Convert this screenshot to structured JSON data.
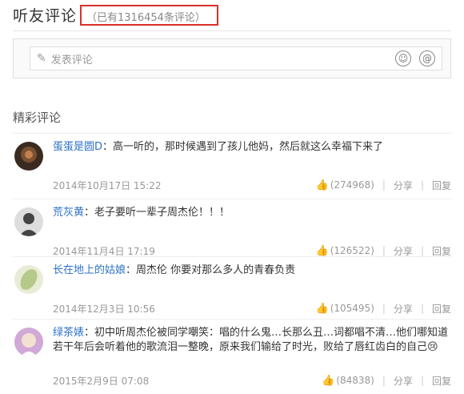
{
  "header": {
    "title": "听友评论",
    "count_text": "（已有1316454条评论）"
  },
  "comment_input": {
    "placeholder": "发表评论"
  },
  "section": {
    "title": "精彩评论"
  },
  "actions": {
    "share": "分享",
    "reply": "回复"
  },
  "comments": [
    {
      "name": "蛋蛋是圆D",
      "text": "：高一听的，那时候遇到了孩儿他妈，然后就这么幸福下来了",
      "date": "2014年10月17日 15:22",
      "likes": "(274968)",
      "avatar_icon": "avatar-photo-icon",
      "avatar_color": "#5a4030"
    },
    {
      "name": "荒灰黄",
      "text": "：老子要听一辈子周杰伦！！！",
      "date": "2014年11月4日 17:19",
      "likes": "(126522)",
      "avatar_icon": "avatar-portrait-icon",
      "avatar_color": "#444444"
    },
    {
      "name": "长在地上的姑娘",
      "text": "：周杰伦 你要对那么多人的青春负责",
      "date": "2014年12月3日 10:56",
      "likes": "(105495)",
      "avatar_icon": "avatar-leaf-icon",
      "avatar_color": "#b5c98a"
    },
    {
      "name": "绿茶婊",
      "text": "：初中听周杰伦被同学嘲笑：唱的什么鬼…长那么丑…词都唱不清…他们哪知道若干年后会听着他的歌流泪一整晚，原来我们输给了时光，败给了唇红齿白的自己😢",
      "date": "2015年2月9日 07:08",
      "likes": "(84838)",
      "avatar_icon": "avatar-cartoon-icon",
      "avatar_color": "#d0a9d6"
    }
  ]
}
